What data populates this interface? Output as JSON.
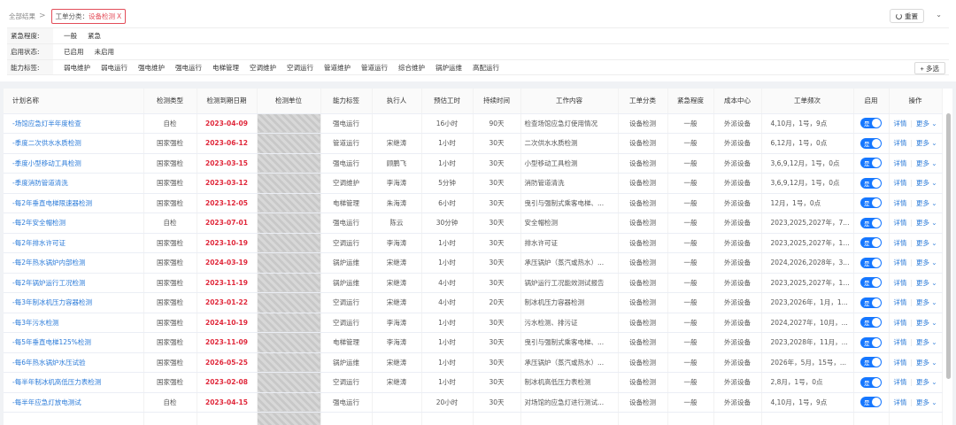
{
  "breadcrumb": {
    "root": "全部结果",
    "sep": ">"
  },
  "filter_chip": {
    "key": "工单分类：",
    "value": "设备检测",
    "close": "X"
  },
  "reset_label": "重置",
  "collapse_icon": "⌄",
  "filters": [
    {
      "label": "紧急程度:",
      "options": [
        "一般",
        "紧急"
      ]
    },
    {
      "label": "启用状态:",
      "options": [
        "已启用",
        "未启用"
      ]
    },
    {
      "label": "能力标签:",
      "options": [
        "弱电维护",
        "弱电运行",
        "强电维护",
        "强电运行",
        "电梯管理",
        "空调维护",
        "空调运行",
        "管道维护",
        "管道运行",
        "综合维护",
        "锅炉运维",
        "高配运行"
      ]
    }
  ],
  "multi_label": "+ 多选",
  "table": {
    "headers": [
      "计划名称",
      "检测类型",
      "检测到期日期",
      "检测单位",
      "能力标签",
      "执行人",
      "预估工时",
      "持续时间",
      "工作内容",
      "工单分类",
      "紧急程度",
      "成本中心",
      "工单频次",
      "启用",
      "操作"
    ],
    "toggle_label": "是",
    "op_detail": "详情",
    "op_more": "更多 ⌄",
    "rows": [
      [
        "-场馆应急灯半年度检查",
        "自检",
        "2023-04-09",
        "",
        "强电运行",
        "",
        "16小时",
        "90天",
        "检查场馆应急灯使用情况",
        "设备检测",
        "一般",
        "外派设备",
        "4,10月，1号，9点"
      ],
      [
        "-季度二次供水水质检测",
        "国家强检",
        "2023-06-12",
        "",
        "管道运行",
        "宋继涛",
        "1小时",
        "30天",
        "二次供水水质检测",
        "设备检测",
        "一般",
        "外派设备",
        "6,12月，1号，0点"
      ],
      [
        "-季度小型移动工具检测",
        "国家强检",
        "2023-03-15",
        "",
        "强电运行",
        "顾鹏飞",
        "1小时",
        "30天",
        "小型移动工具检测",
        "设备检测",
        "一般",
        "外派设备",
        "3,6,9,12月，1号，0点"
      ],
      [
        "-季度消防管道清洗",
        "国家强检",
        "2023-03-12",
        "",
        "空调维护",
        "李海涛",
        "5分钟",
        "30天",
        "消防管道清洗",
        "设备检测",
        "一般",
        "外派设备",
        "3,6,9,12月，1号，0点"
      ],
      [
        "-每2年垂直电梯限速器检测",
        "国家强检",
        "2023-12-05",
        "",
        "电梯管理",
        "朱海涛",
        "6小时",
        "30天",
        "曳引与强制式乘客电梯、...",
        "设备检测",
        "一般",
        "外派设备",
        "12月，1号，0点"
      ],
      [
        "-每2年安全帽检测",
        "自检",
        "2023-07-01",
        "",
        "强电运行",
        "陈云",
        "30分钟",
        "30天",
        "安全帽检测",
        "设备检测",
        "一般",
        "外派设备",
        "2023,2025,2027年，7..."
      ],
      [
        "-每2年排水许可证",
        "国家强检",
        "2023-10-19",
        "",
        "空调运行",
        "李海涛",
        "1小时",
        "30天",
        "排水许可证",
        "设备检测",
        "一般",
        "外派设备",
        "2023,2025,2027年，10..."
      ],
      [
        "-每2年热水锅炉内部检测",
        "国家强检",
        "2024-03-19",
        "",
        "锅炉运维",
        "宋继涛",
        "1小时",
        "30天",
        "承压锅炉（蒸汽或热水）...",
        "设备检测",
        "一般",
        "外派设备",
        "2024,2026,2028年，3..."
      ],
      [
        "-每2年锅炉运行工况检测",
        "国家强检",
        "2023-11-19",
        "",
        "锅炉运维",
        "宋继涛",
        "4小时",
        "30天",
        "锅炉运行工况能效测试报告",
        "设备检测",
        "一般",
        "外派设备",
        "2023,2025,2027年，11..."
      ],
      [
        "-每3年制冰机压力容器检测",
        "国家强检",
        "2023-01-22",
        "",
        "空调运行",
        "宋继涛",
        "4小时",
        "20天",
        "制冰机压力容器检测",
        "设备检测",
        "一般",
        "外派设备",
        "2023,2026年，1月，1..."
      ],
      [
        "-每3年污水检测",
        "国家强检",
        "2024-10-19",
        "",
        "空调运行",
        "李海涛",
        "1小时",
        "30天",
        "污水检测、排污证",
        "设备检测",
        "一般",
        "外派设备",
        "2024,2027年，10月，..."
      ],
      [
        "-每5年垂直电梯125%检测",
        "国家强检",
        "2023-11-09",
        "",
        "电梯管理",
        "李海涛",
        "1小时",
        "30天",
        "曳引与强制式乘客电梯、...",
        "设备检测",
        "一般",
        "外派设备",
        "2023,2028年，11月，..."
      ],
      [
        "-每6年热水锅炉水压试验",
        "国家强检",
        "2026-05-25",
        "",
        "锅炉运维",
        "宋继涛",
        "1小时",
        "30天",
        "承压锅炉（蒸汽或热水）...",
        "设备检测",
        "一般",
        "外派设备",
        "2026年，5月，15号，..."
      ],
      [
        "-每半年制冰机高低压力表检测",
        "国家强检",
        "2023-02-08",
        "",
        "空调运行",
        "宋继涛",
        "1小时",
        "30天",
        "制冰机高低压力表检测",
        "设备检测",
        "一般",
        "外派设备",
        "2,8月，1号，0点"
      ],
      [
        "-每半年应急灯放电测试",
        "自检",
        "2023-04-15",
        "",
        "强电运行",
        "",
        "20小时",
        "30天",
        "对场馆的应急灯进行测试...",
        "设备检测",
        "一般",
        "外派设备",
        "4,10月，1号，9点"
      ],
      [
        "",
        "",
        "",
        "",
        "",
        "",
        "",
        "",
        "",
        "",
        "",
        "",
        ""
      ]
    ]
  }
}
